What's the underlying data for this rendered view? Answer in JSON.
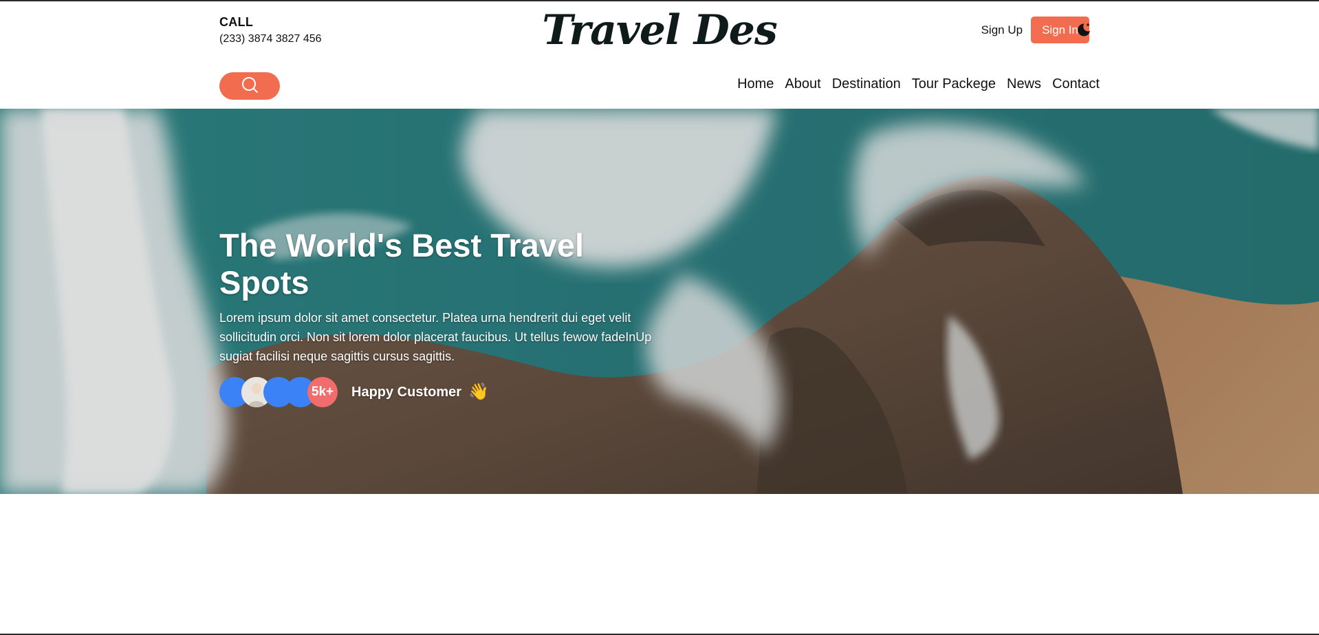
{
  "header": {
    "call_label": "CALL",
    "phone": "(233) 3874 3827 456",
    "logo": "Travel Des",
    "sign_up": "Sign Up",
    "sign_in": "Sign In",
    "theme_icon": "moon-sparkle-icon",
    "search_icon": "search-icon"
  },
  "nav": {
    "items": [
      "Home",
      "About",
      "Destination",
      "Tour Packege",
      "News",
      "Contact"
    ]
  },
  "hero": {
    "title": "The World's Best Travel Spots",
    "description": "Lorem ipsum dolor sit amet consectetur. Platea urna hendrerit dui eget velit sollicitudin orci. Non sit lorem dolor placerat faucibus. Ut tellus fewow fadeInUp sugiat facilisi neque sagittis cursus sagittis.",
    "customer_count": "5k+",
    "customer_label": "Happy Customer",
    "wave_emoji": "👋"
  },
  "colors": {
    "accent": "#f26d50",
    "avatar_blue": "#3b82f6",
    "count_badge": "#f16d6d"
  }
}
